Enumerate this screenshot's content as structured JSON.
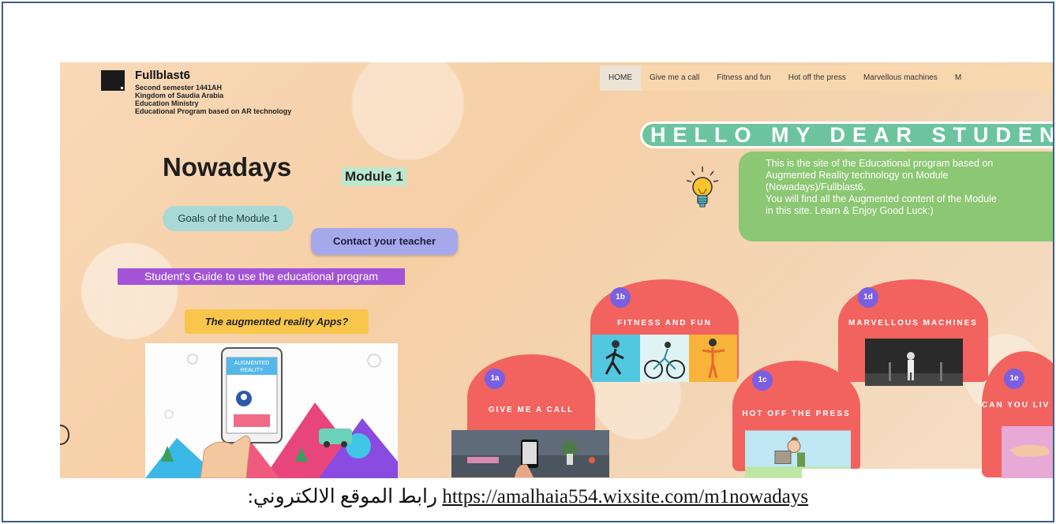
{
  "site": {
    "brand_title": "Fullblast6",
    "brand_lines": [
      "Second semester 1441AH",
      "Kingdom of Saudia Arabia",
      "Education Ministry",
      "Educational Program based on AR technology"
    ],
    "nav": [
      {
        "label": "HOME",
        "active": true
      },
      {
        "label": "Give me a call",
        "active": false
      },
      {
        "label": "Fitness and fun",
        "active": false
      },
      {
        "label": "Hot off the press",
        "active": false
      },
      {
        "label": "Marvellous machines",
        "active": false
      },
      {
        "label": "M",
        "active": false
      }
    ],
    "hello": "HELLO MY DEAR STUDENT",
    "welcome_lines": [
      "This is the site of the Educational program based on",
      "Augmented   Reality   technology   on   Module",
      "(Nowadays)/Fullblast6.",
      "You will find all the Augmented content of the Module",
      "in this site. Learn & Enjoy                      Good Luck:)"
    ],
    "nowadays_title": "Nowadays",
    "module_tag": "Module 1",
    "goals_button": "Goals of the Module 1",
    "contact_button": "Contact your teacher",
    "guide_button": "Student's Guide to use the educational program",
    "apps_button": "The augmented reality Apps?",
    "ar_label_line1": "AUGMENTED",
    "ar_label_line2": "REALITY",
    "modules": [
      {
        "badge": "1a",
        "title": "GIVE ME A CALL"
      },
      {
        "badge": "1b",
        "title": "FITNESS AND FUN"
      },
      {
        "badge": "1c",
        "title": "HOT OFF THE PRESS"
      },
      {
        "badge": "1d",
        "title": "MARVELLOUS MACHINES"
      },
      {
        "badge": "1e",
        "title": "CAN YOU LIV"
      }
    ]
  },
  "caption": {
    "arabic": "رابط الموقع الالكتروني:",
    "url": "https://amalhaia554.wixsite.com/m1nowadays"
  },
  "colors": {
    "hello_bg": "#6cc49e",
    "welcome_bg": "#8cc773",
    "module_blob": "#f2625f",
    "badge": "#7a5fe0",
    "guide_bg": "#a353d6",
    "apps_bg": "#f8c64a",
    "contact_bg": "#a5a8ea",
    "goals_bg": "#a9d9d6"
  }
}
